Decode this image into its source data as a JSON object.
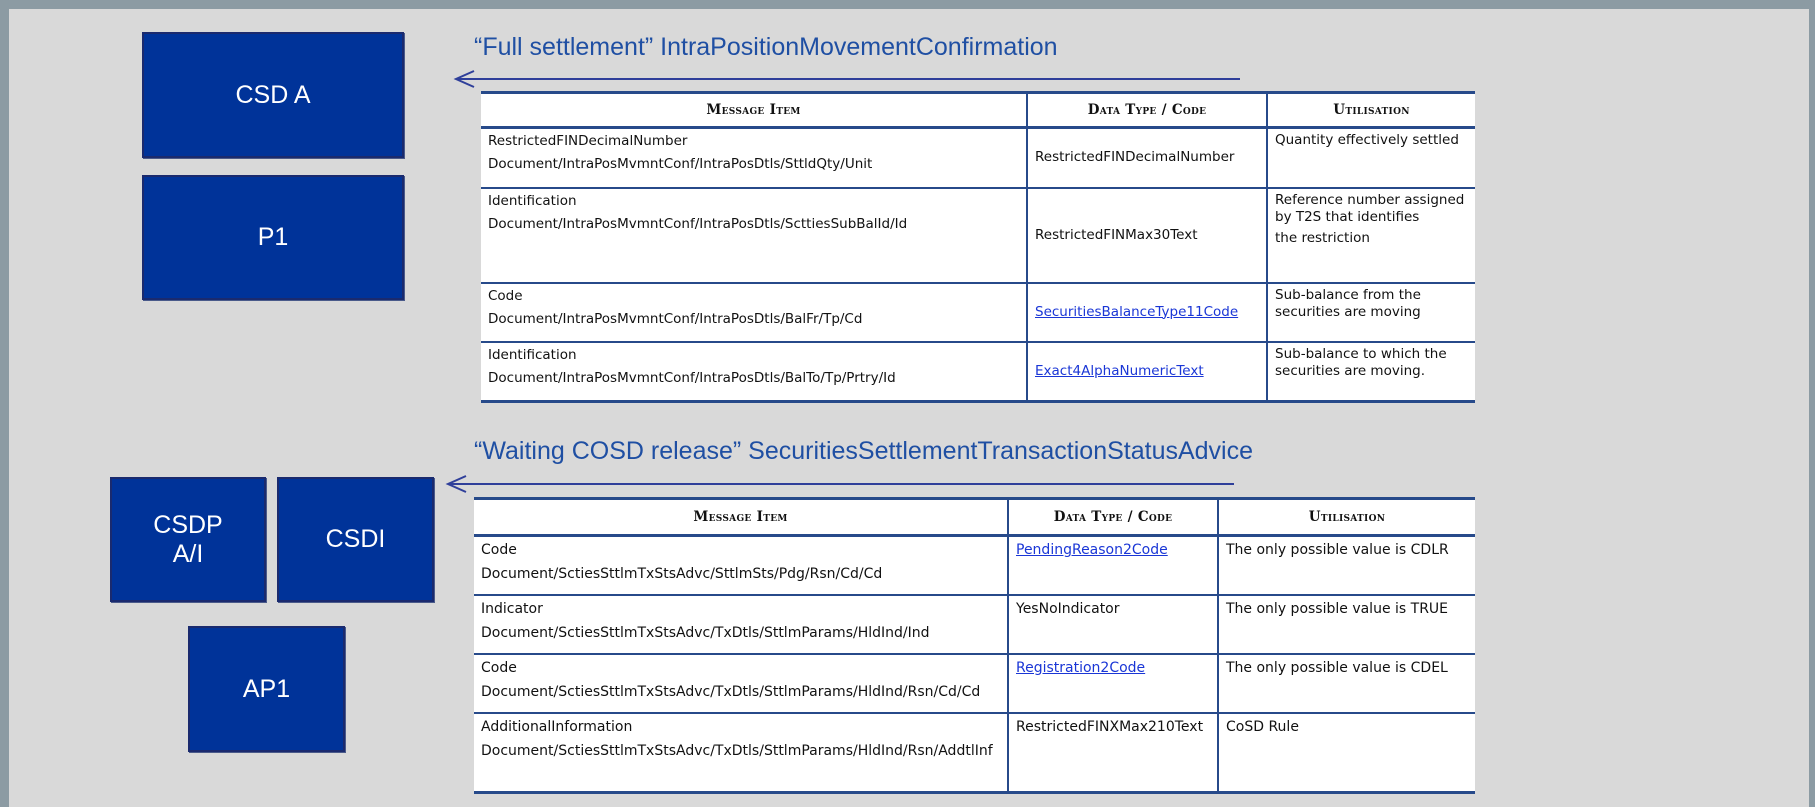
{
  "top": {
    "heading": "“Full settlement” IntraPositionMovementConfirmation",
    "boxes": {
      "csd_a": "CSD A",
      "p1": "P1"
    },
    "table": {
      "headers": [
        "Message Item",
        "Data Type / Code",
        "Utilisation"
      ],
      "rows": [
        {
          "item_name": "RestrictedFINDecimalNumber",
          "item_path": "Document/IntraPosMvmntConf/IntraPosDtls/SttldQty/Unit",
          "type": "RestrictedFINDecimalNumber",
          "type_link": false,
          "util": "Quantity effectively settled",
          "util_extra": ""
        },
        {
          "item_name": "Identification",
          "item_path": "Document/IntraPosMvmntConf/IntraPosDtls/ScttiesSubBalId/Id",
          "type": "RestrictedFINMax30Text",
          "type_link": false,
          "util": "Reference number assigned by T2S that identifies",
          "util_extra": "the restriction"
        },
        {
          "item_name": "Code",
          "item_path": "Document/IntraPosMvmntConf/IntraPosDtls/BalFr/Tp/Cd",
          "type": "SecuritiesBalanceType11Code",
          "type_link": true,
          "util": "Sub-balance from the securities are moving",
          "util_extra": ""
        },
        {
          "item_name": "Identification",
          "item_path": "Document/IntraPosMvmntConf/IntraPosDtls/BalTo/Tp/Prtry/Id",
          "type": "Exact4AlphaNumericText",
          "type_link": true,
          "util": "Sub-balance to which the securities are moving.",
          "util_extra": ""
        }
      ]
    }
  },
  "bottom": {
    "heading": "“Waiting COSD release” SecuritiesSettlementTransactionStatusAdvice",
    "boxes": {
      "csdp": "CSDP\nA/I",
      "csdi": "CSDI",
      "ap1": "AP1"
    },
    "table": {
      "headers": [
        "Message Item",
        "Data Type / Code",
        "Utilisation"
      ],
      "rows": [
        {
          "item_name": "Code",
          "item_path": "Document/SctiesSttlmTxStsAdvc/SttlmSts/Pdg/Rsn/Cd/Cd",
          "type": "PendingReason2Code",
          "type_link": true,
          "util": "The only possible value is CDLR"
        },
        {
          "item_name": "Indicator",
          "item_path": "Document/SctiesSttlmTxStsAdvc/TxDtls/SttlmParams/HldInd/Ind",
          "type": "YesNoIndicator",
          "type_link": false,
          "util": "The only possible value is TRUE"
        },
        {
          "item_name": "Code",
          "item_path": "Document/SctiesSttlmTxStsAdvc/TxDtls/SttlmParams/HldInd/Rsn/Cd/Cd",
          "type": "Registration2Code",
          "type_link": true,
          "util": "The only possible value is CDEL"
        },
        {
          "item_name": "AdditionalInformation",
          "item_path": "Document/SctiesSttlmTxStsAdvc/TxDtls/SttlmParams/HldInd/Rsn/AddtlInf",
          "type": "RestrictedFINXMax210Text",
          "type_link": false,
          "util": "CoSD Rule"
        }
      ]
    }
  },
  "colors": {
    "box": "#003399",
    "heading": "#1f4fa3",
    "rule": "#274a8a",
    "link": "#1a36d6",
    "background": "#d9d9d9"
  }
}
